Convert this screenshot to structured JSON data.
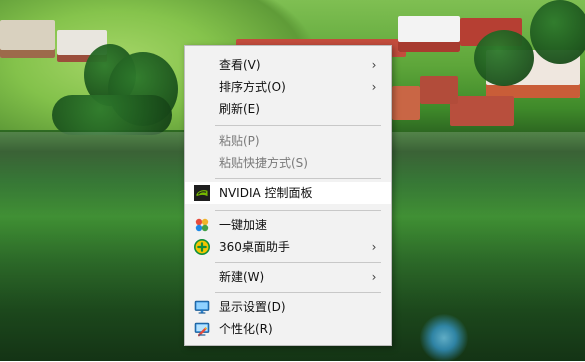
{
  "context_menu": {
    "items": [
      {
        "label": "查看(V)",
        "has_submenu": true,
        "disabled": false
      },
      {
        "label": "排序方式(O)",
        "has_submenu": true,
        "disabled": false
      },
      {
        "label": "刷新(E)",
        "has_submenu": false,
        "disabled": false
      },
      {
        "label": "粘贴(P)",
        "has_submenu": false,
        "disabled": true
      },
      {
        "label": "粘贴快捷方式(S)",
        "has_submenu": false,
        "disabled": true
      },
      {
        "label": "NVIDIA 控制面板",
        "has_submenu": false,
        "disabled": false,
        "icon": "nvidia-icon"
      },
      {
        "label": "一键加速",
        "has_submenu": false,
        "disabled": false,
        "icon": "accelerate-icon"
      },
      {
        "label": "360桌面助手",
        "has_submenu": true,
        "disabled": false,
        "icon": "desktop-assistant-icon"
      },
      {
        "label": "新建(W)",
        "has_submenu": true,
        "disabled": false
      },
      {
        "label": "显示设置(D)",
        "has_submenu": false,
        "disabled": false,
        "icon": "display-settings-icon"
      },
      {
        "label": "个性化(R)",
        "has_submenu": false,
        "disabled": false,
        "icon": "personalize-icon"
      }
    ],
    "submenu_glyph": "›",
    "highlighted_item": "NVIDIA 控制面板"
  },
  "theme": {
    "menu_background": "#f2f2f2",
    "menu_border": "#bdbdbd",
    "separator": "#c8c8c8",
    "disabled_text": "#7a7a7a",
    "highlight": "#ffffff"
  },
  "desktop": {
    "wallpaper_subject": "village-lake-wallpaper"
  }
}
